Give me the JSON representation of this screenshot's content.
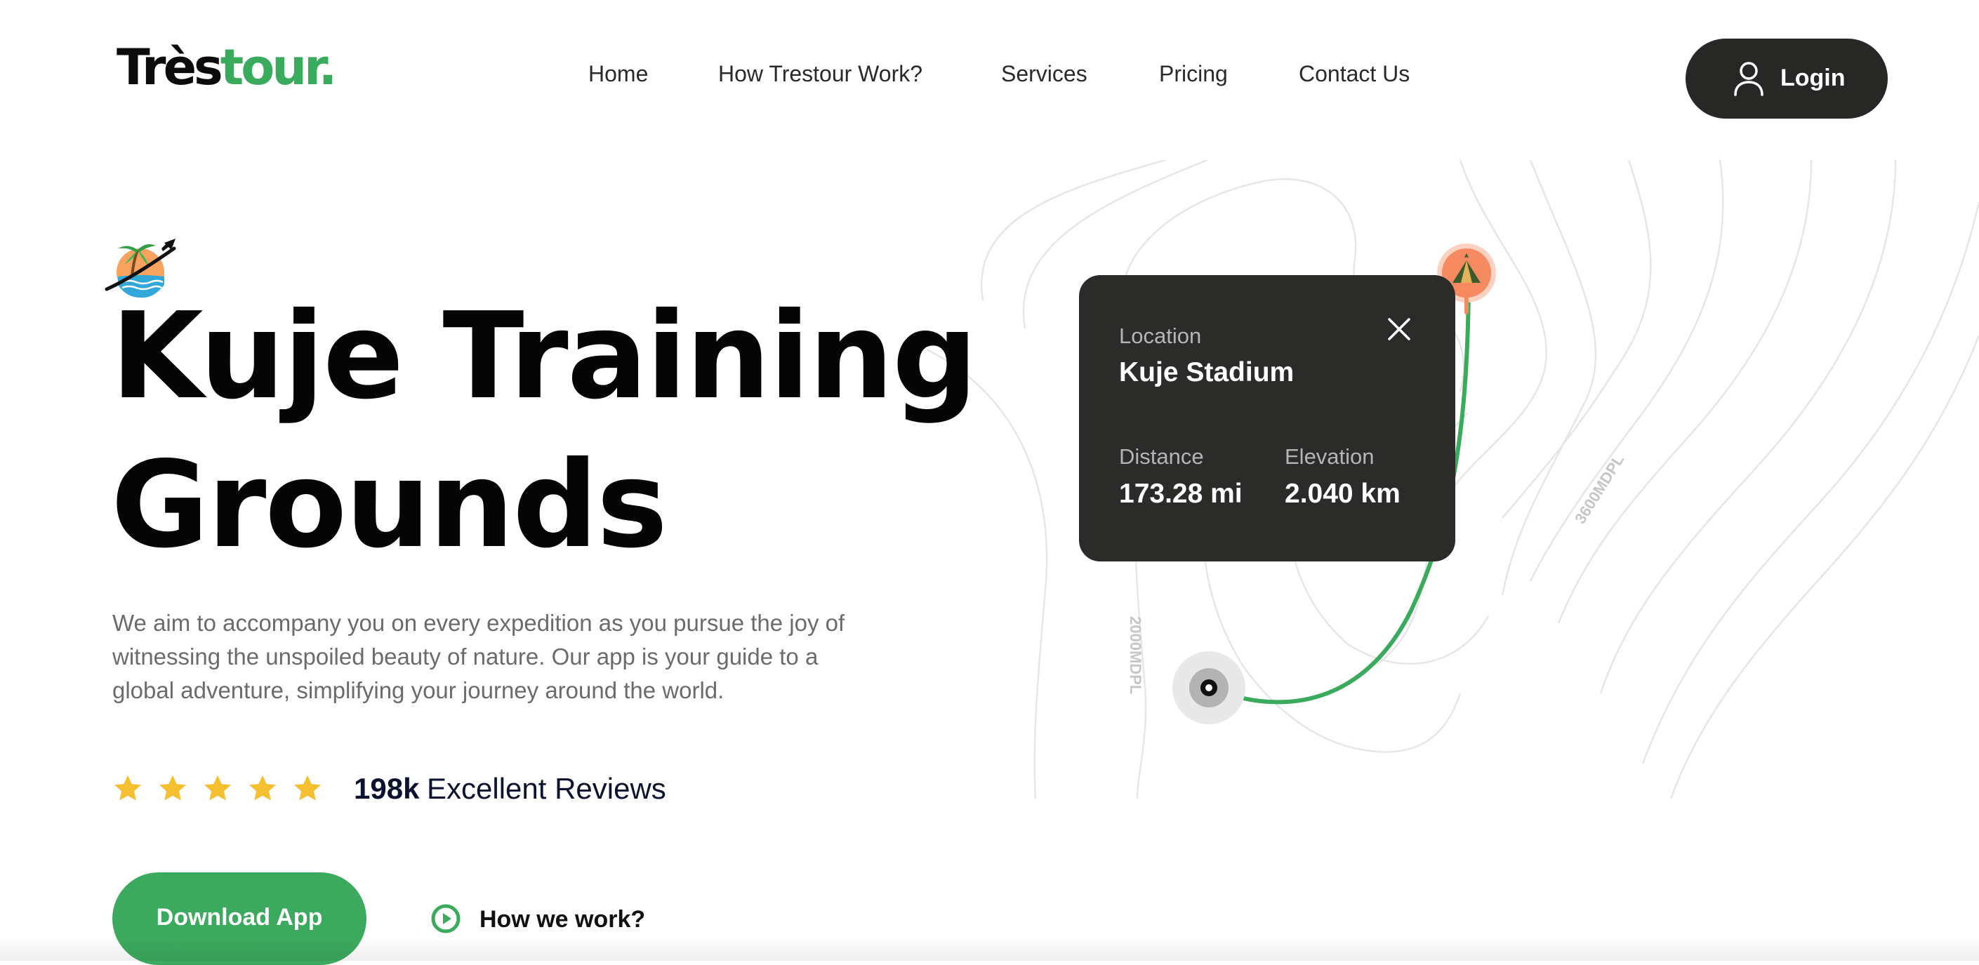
{
  "brand": {
    "part1": "Très",
    "part2": "tour.",
    "accent_color": "#3aaa5c"
  },
  "nav": {
    "items": [
      {
        "label": "Home"
      },
      {
        "label": "How Trestour Work?"
      },
      {
        "label": "Services"
      },
      {
        "label": "Pricing"
      },
      {
        "label": "Contact Us"
      }
    ]
  },
  "login": {
    "label": "Login",
    "icon": "user-icon",
    "bg_color": "#272825"
  },
  "hero": {
    "icon": "palm-island-plane-icon",
    "title_line1": "Kuje Training",
    "title_line2": "Grounds",
    "description": "We aim to accompany you on every expedition as you pursue the joy of witnessing the unspoiled beauty of nature. Our app is your guide to a global adventure, simplifying your journey around the world."
  },
  "rating": {
    "stars": 5,
    "star_color": "#f5bf32",
    "count": "198k",
    "label": "Excellent Reviews"
  },
  "cta": {
    "download_label": "Download App",
    "download_color": "#3caa5e",
    "how_label": "How we work?",
    "how_icon": "play-circle-icon"
  },
  "map": {
    "contour_label_right": "3600MDPL",
    "contour_label_left": "2000MDPL",
    "route_color": "#3aaa5c",
    "destination_pin_icon": "tent-icon",
    "destination_pin_color": "#f58a60",
    "start_pin_icon": "start-point-icon"
  },
  "location_card": {
    "location_label": "Location",
    "location_value": "Kuje Stadium",
    "distance_label": "Distance",
    "distance_value": "173.28 mi",
    "elevation_label": "Elevation",
    "elevation_value": "2.040 km",
    "bg_color": "#2b2c29"
  }
}
